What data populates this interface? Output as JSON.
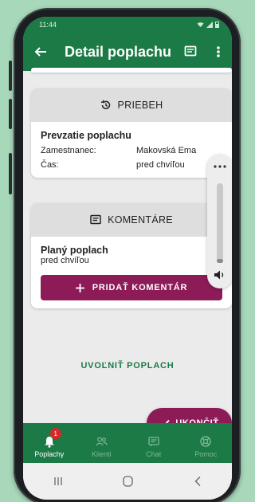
{
  "status_bar": {
    "time": "11:44"
  },
  "app_bar": {
    "title": "Detail poplachu"
  },
  "progress_card": {
    "title": "PRIEBEH",
    "event_title": "Prevzatie poplachu",
    "rows": [
      {
        "label": "Zamestnanec:",
        "value": "Makovská Ema"
      },
      {
        "label": "Čas:",
        "value": "pred chvíľou"
      }
    ]
  },
  "comments_card": {
    "title": "KOMENTÁRE",
    "comment_title": "Planý poplach",
    "comment_time": "pred chvíľou",
    "add_label": "PRIDAŤ KOMENTÁR"
  },
  "release_label": "UVOĽNIŤ POPLACH",
  "finish_label": "UKONČIŤ",
  "volume": {
    "level": 0.05
  },
  "bottom_nav": {
    "items": [
      {
        "label": "Poplachy",
        "badge": "1",
        "icon": "bell-icon",
        "active": true
      },
      {
        "label": "Klienti",
        "icon": "people-icon",
        "active": false
      },
      {
        "label": "Chat",
        "icon": "chat-icon",
        "active": false
      },
      {
        "label": "Pomoc",
        "icon": "lifebuoy-icon",
        "active": false
      }
    ]
  },
  "colors": {
    "primary": "#1b7a45",
    "accent": "#8c1b58",
    "badge": "#d62828"
  }
}
